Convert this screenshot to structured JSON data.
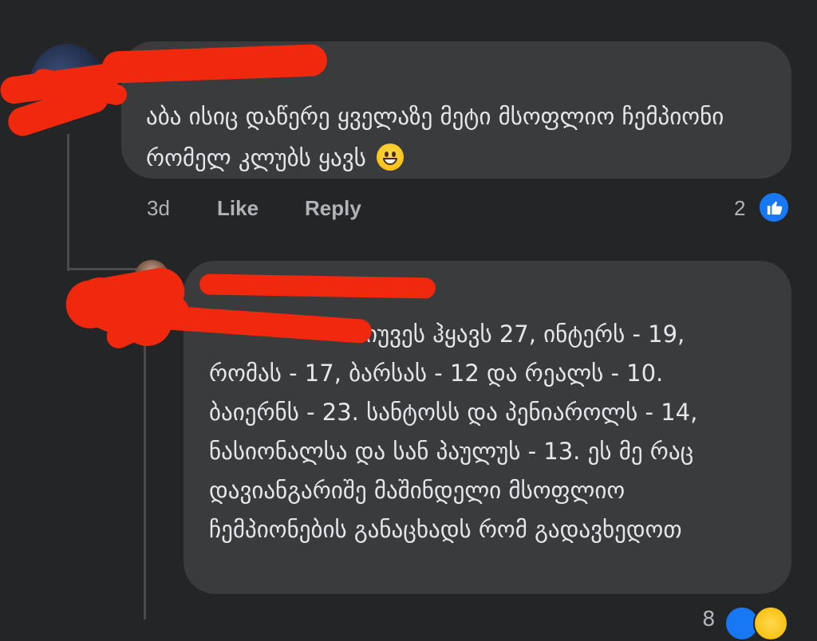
{
  "comment1": {
    "author": "",
    "text": "აბა ისიც დაწერე ყველაზე მეტი მსოფლიო ჩემპიონი რომელ კლუბს ყავს",
    "emoji": "grinning-face",
    "time": "3d",
    "like_label": "Like",
    "reply_label": "Reply",
    "reaction_count": "2"
  },
  "comment2": {
    "author": "",
    "mention": "",
    "text": "იუვეს ჰყავს 27, ინტერს - 19, რომას - 17, ბარსას - 12 და რეალს - 10. ბაიერნს - 23. სანტოსს და პენიაროლს - 14,  ნასიონალსა და სან პაულუს - 13. ეს მე რაც დავიანგარიშე მაშინდელი მსოფლიო ჩემპიონების განაცხადს რომ გადავხედოთ",
    "reaction_count": "8"
  },
  "colors": {
    "background": "#242526",
    "bubble": "#3a3b3c",
    "text": "#e4e6eb",
    "meta": "#b0b3b8",
    "mention": "#4599ff",
    "like_badge": "#1877f2",
    "redaction": "#f0280e"
  }
}
